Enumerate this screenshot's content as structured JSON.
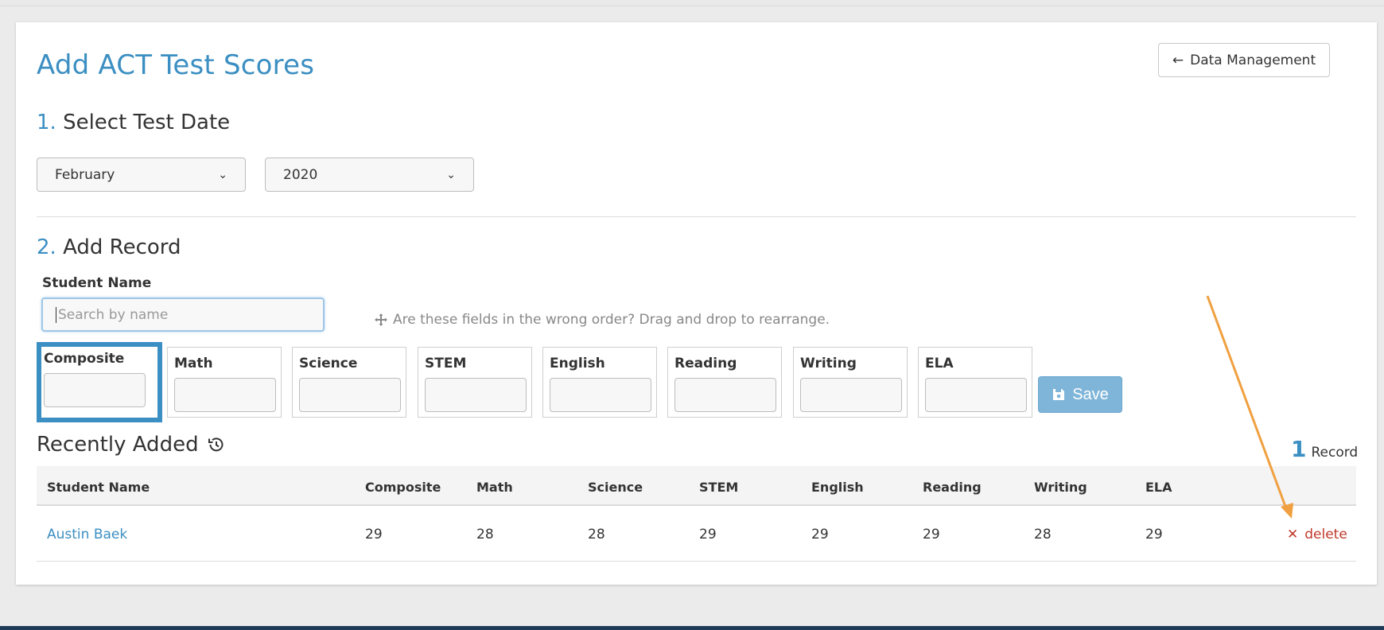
{
  "page": {
    "title": "Add ACT Test Scores",
    "back_button_label": "Data Management"
  },
  "step1": {
    "number": "1.",
    "title": "Select Test Date",
    "month_value": "February",
    "year_value": "2020"
  },
  "step2": {
    "number": "2.",
    "title": "Add Record",
    "student_name_label": "Student Name",
    "search_placeholder": "Search by name",
    "drag_hint": "Are these fields in the wrong order? Drag and drop to rearrange.",
    "fields": [
      "Composite",
      "Math",
      "Science",
      "STEM",
      "English",
      "Reading",
      "Writing",
      "ELA"
    ],
    "save_label": "Save"
  },
  "recent": {
    "title": "Recently Added",
    "record_count": "1",
    "record_label": "Record",
    "columns": [
      "Student Name",
      "Composite",
      "Math",
      "Science",
      "STEM",
      "English",
      "Reading",
      "Writing",
      "ELA"
    ],
    "rows": [
      {
        "student": "Austin Baek",
        "scores": [
          "29",
          "28",
          "28",
          "29",
          "29",
          "29",
          "28",
          "29"
        ],
        "delete_label": "delete"
      }
    ]
  },
  "colors": {
    "accent": "#3b8fc2",
    "delete": "#c0392b",
    "annotation_arrow": "#f0a040"
  },
  "icons": [
    "arrow-left-icon",
    "chevron-down-icon",
    "move-icon",
    "floppy-disk-icon",
    "history-icon",
    "close-icon"
  ]
}
